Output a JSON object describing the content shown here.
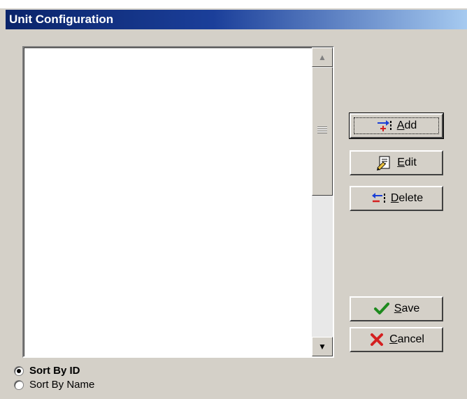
{
  "window": {
    "title": "Unit Configuration"
  },
  "buttons": {
    "add": {
      "prefix": "",
      "accel": "A",
      "rest": "dd"
    },
    "edit": {
      "prefix": "",
      "accel": "E",
      "rest": "dit"
    },
    "delete": {
      "prefix": "",
      "accel": "D",
      "rest": "elete"
    },
    "save": {
      "prefix": "",
      "accel": "S",
      "rest": "ave"
    },
    "cancel": {
      "prefix": "",
      "accel": "C",
      "rest": "ancel"
    }
  },
  "sort": {
    "by_id": "Sort By ID",
    "by_name": "Sort By Name",
    "selected": "by_id"
  },
  "icons": {
    "add": "add-record-icon",
    "edit": "edit-record-icon",
    "delete": "delete-record-icon",
    "save": "checkmark-icon",
    "cancel": "x-mark-icon"
  },
  "colors": {
    "title_start": "#0a246a",
    "title_end": "#a6caf0",
    "face": "#d4d0c8",
    "check_green": "#1e8a1e",
    "cancel_red": "#d42020"
  }
}
